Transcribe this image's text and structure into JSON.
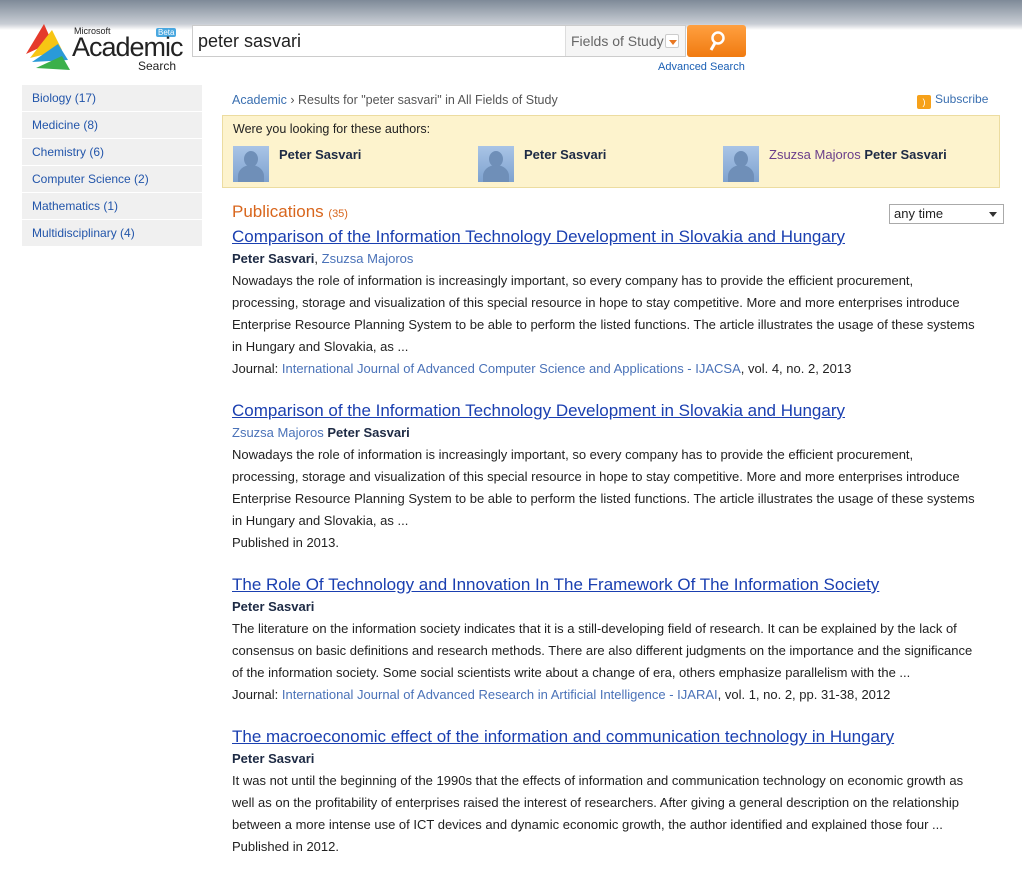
{
  "logo": {
    "microsoft": "Microsoft",
    "academic": "Academic",
    "search": "Search",
    "beta": "Beta"
  },
  "search": {
    "value": "peter sasvari",
    "fields": "Fields of Study",
    "go_icon": "search-icon",
    "advanced": "Advanced Search"
  },
  "sidebar": [
    {
      "label": "Biology (17)"
    },
    {
      "label": "Medicine (8)"
    },
    {
      "label": "Chemistry (6)"
    },
    {
      "label": "Computer Science (2)"
    },
    {
      "label": "Mathematics (1)"
    },
    {
      "label": "Multidisciplinary (4)"
    }
  ],
  "breadcrumb": {
    "root": "Academic",
    "sep": "›",
    "text": " Results for \"peter sasvari\" in All Fields of Study"
  },
  "subscribe": "Subscribe",
  "did_you_mean": {
    "prompt": "Were you looking for these authors:",
    "authors": [
      {
        "pre": "",
        "name": "Peter Sasvari"
      },
      {
        "pre": "",
        "name": "Peter Sasvari"
      },
      {
        "pre": "Zsuzsa Majoros ",
        "name": "Peter Sasvari"
      }
    ]
  },
  "publications": {
    "label": "Publications",
    "count": "(35)",
    "filter": "any time"
  },
  "results": [
    {
      "title": "Comparison of the Information Technology Development in Slovakia and Hungary",
      "authors": [
        {
          "name": "Peter Sasvari",
          "bold": true,
          "after": ", "
        },
        {
          "name": "Zsuzsa Majoros",
          "bold": false,
          "after": ""
        }
      ],
      "abstract": "Nowadays the role of information is increasingly important, so every company has to provide the efficient procurement, processing, storage and visualization of this special resource in hope to stay competitive. More and more enterprises introduce Enterprise Resource Planning System to be able to perform the listed functions. The article illustrates the usage of these systems in Hungary and Slovakia, as ...",
      "venue_prefix": "Journal: ",
      "venue": "International Journal of Advanced Computer Science and Applications - IJACSA",
      "venue_suffix": ", vol. 4, no. 2, 2013"
    },
    {
      "title": "Comparison of the Information Technology Development in Slovakia and Hungary",
      "authors": [
        {
          "name": "Zsuzsa Majoros",
          "bold": false,
          "after": " "
        },
        {
          "name": "Peter Sasvari",
          "bold": true,
          "after": ""
        }
      ],
      "abstract": "Nowadays the role of information is increasingly important, so every company has to provide the efficient procurement, processing, storage and visualization of this special resource in hope to stay competitive. More and more enterprises introduce Enterprise Resource Planning System to be able to perform the listed functions. The article illustrates the usage of these systems in Hungary and Slovakia, as ...",
      "venue_prefix": "Published in 2013.",
      "venue": "",
      "venue_suffix": ""
    },
    {
      "title": "The Role Of Technology and Innovation In The Framework Of The Information Society",
      "authors": [
        {
          "name": "Peter Sasvari",
          "bold": true,
          "after": ""
        }
      ],
      "abstract": "The literature on the information society indicates that it is a still-developing field of research. It can be explained by the lack of consensus on basic definitions and research methods. There are also different judgments on the importance and the significance of the information society. Some social scientists write about a change of era, others emphasize parallelism with the ...",
      "venue_prefix": "Journal: ",
      "venue": "International Journal of Advanced Research in Artificial Intelligence - IJARAI",
      "venue_suffix": ", vol. 1, no. 2, pp. 31-38, 2012"
    },
    {
      "title": "The macroeconomic effect of the information and communication technology in Hungary",
      "authors": [
        {
          "name": "Peter Sasvari",
          "bold": true,
          "after": ""
        }
      ],
      "abstract": "It was not until the beginning of the 1990s that the effects of information and communication technology on economic growth as well as on the profitability of enterprises raised the interest of researchers. After giving a general description on the relationship between a more intense use of ICT devices and dynamic economic growth, the author identified and explained those four ...",
      "venue_prefix": "Published in 2012.",
      "venue": "",
      "venue_suffix": ""
    }
  ]
}
